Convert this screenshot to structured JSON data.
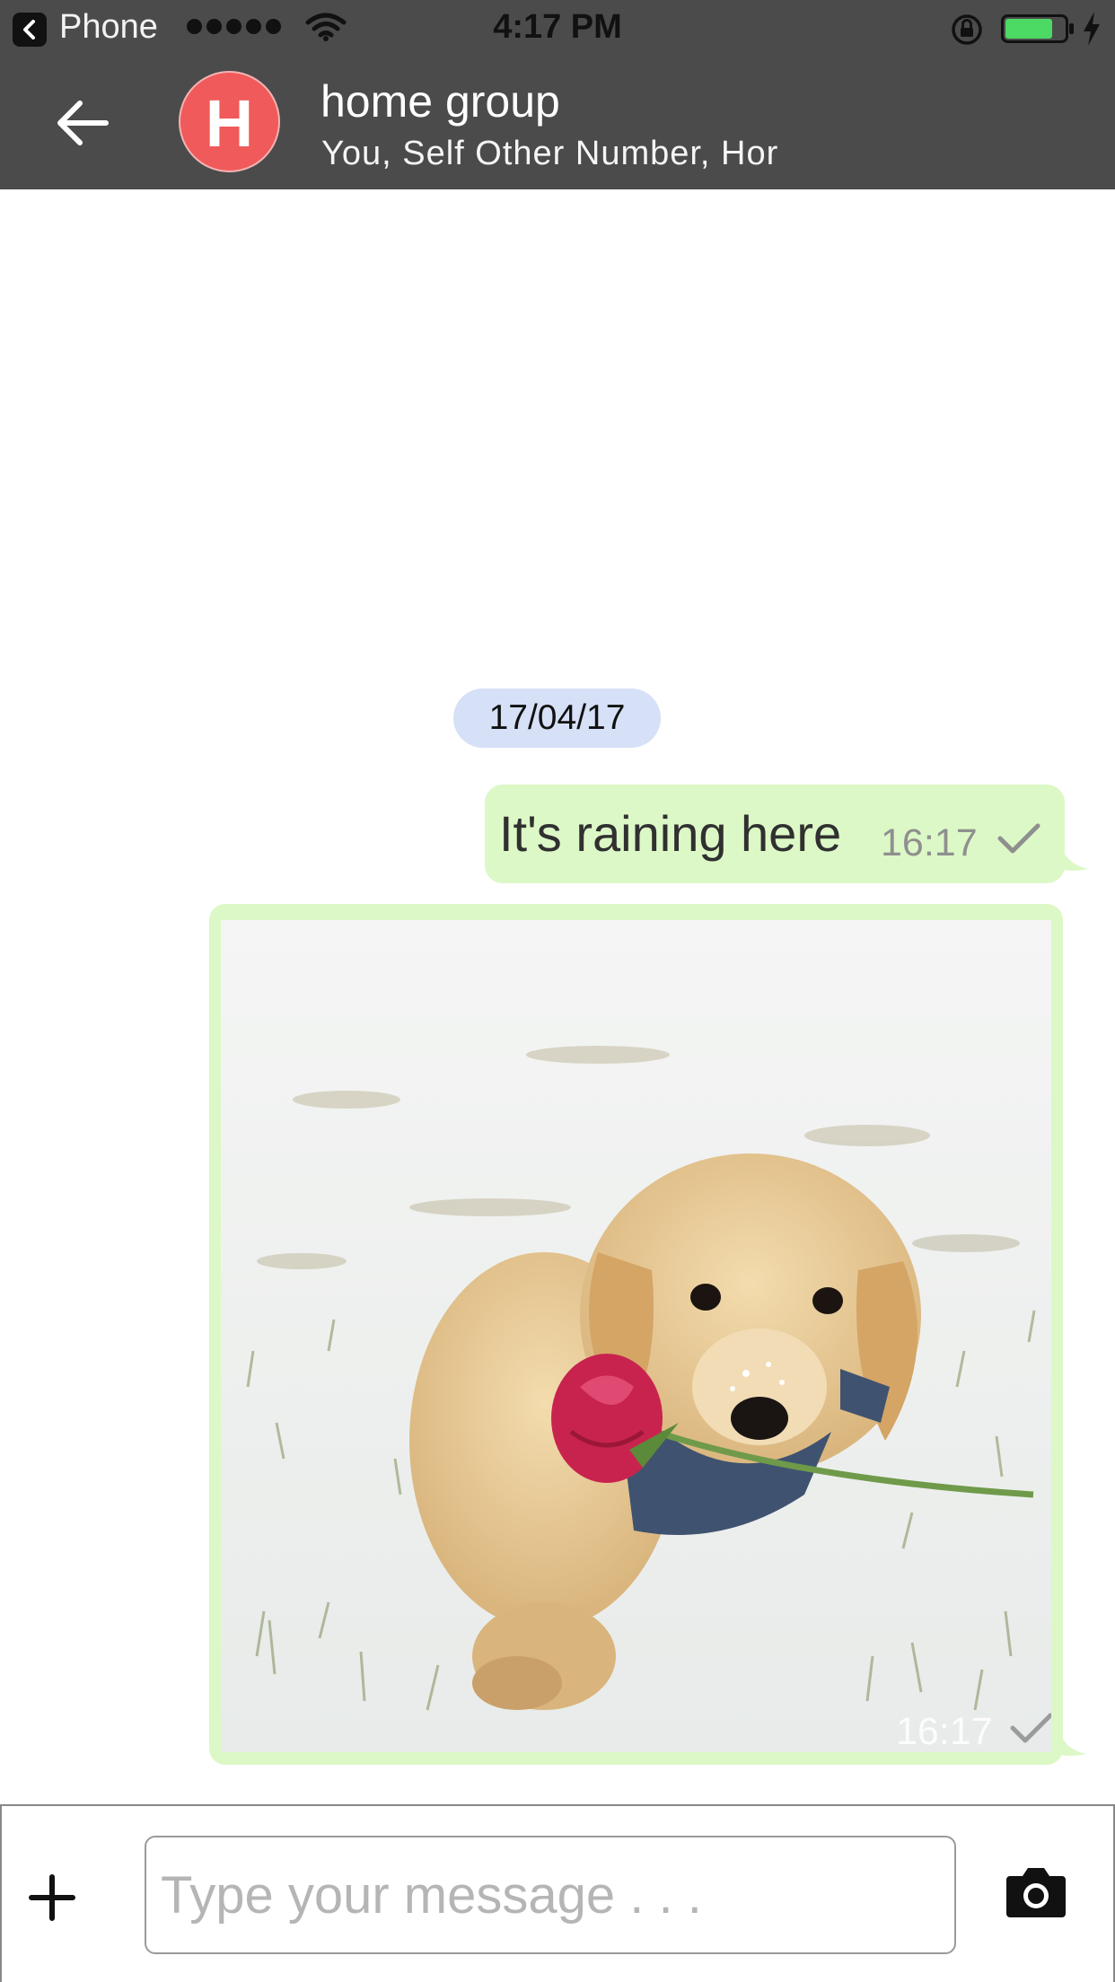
{
  "status_bar": {
    "carrier": "Phone",
    "time": "4:17 PM"
  },
  "header": {
    "avatar_letter": "H",
    "title": "home group",
    "subtitle": "You, Self Other Number, Hor"
  },
  "chat": {
    "date_chip": "17/04/17",
    "messages": [
      {
        "type": "text",
        "text": "It's raining here",
        "time": "16:17",
        "status": "sent"
      },
      {
        "type": "image",
        "time": "16:17",
        "status": "sent"
      }
    ]
  },
  "composer": {
    "placeholder": "Type your message . . ."
  },
  "colors": {
    "header_bg": "#4b4b4b",
    "avatar_bg": "#f05a5a",
    "bubble_out": "#dcf8c6",
    "date_chip": "#d6e0f7"
  }
}
